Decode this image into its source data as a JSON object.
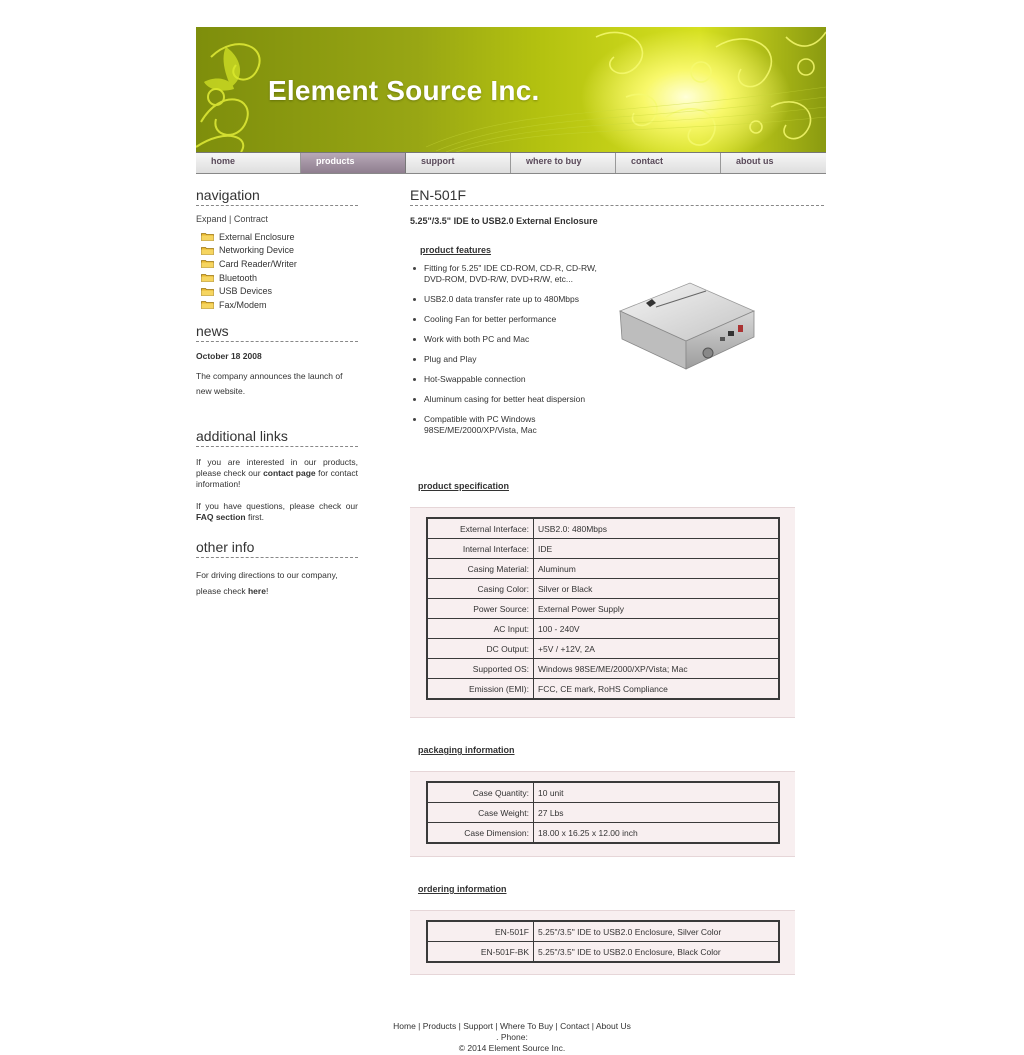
{
  "header": {
    "company": "Element Source Inc."
  },
  "topnav": [
    "home",
    "products",
    "support",
    "where to buy",
    "contact",
    "about us"
  ],
  "sidebar": {
    "nav_title": "navigation",
    "expand": "Expand",
    "separator": "|",
    "contract": "Contract",
    "categories": [
      "External Enclosure",
      "Networking Device",
      "Card Reader/Writer",
      "Bluetooth",
      "USB Devices",
      "Fax/Modem"
    ],
    "news_title": "news",
    "news_date": "October 18 2008",
    "news_text": "The company announces the launch of new website.",
    "links_title": "additional links",
    "links_p1_a": "If you are interested in our products, please check our ",
    "links_p1_b": "contact page",
    "links_p1_c": " for contact information!",
    "links_p2_a": "If you have questions, please check our ",
    "links_p2_b": "FAQ section",
    "links_p2_c": " first.",
    "other_title": "other info",
    "other_a": "For driving directions to our company, please check ",
    "other_b": "here",
    "other_c": "!"
  },
  "product": {
    "model": "EN-501F",
    "subtitle": "5.25\"/3.5\" IDE to USB2.0 External Enclosure",
    "features_title": "product features",
    "features": [
      "Fitting for 5.25\" IDE CD-ROM, CD-R, CD-RW, DVD-ROM, DVD-R/W, DVD+R/W, etc...",
      "USB2.0 data transfer rate up to 480Mbps",
      "Cooling Fan for better performance",
      "Work with both PC and Mac",
      "Plug and Play",
      "Hot-Swappable connection",
      "Aluminum casing for better heat dispersion",
      "Compatible with PC Windows 98SE/ME/2000/XP/Vista, Mac"
    ],
    "spec_title": "product specification",
    "spec": [
      [
        "External Interface:",
        "USB2.0: 480Mbps"
      ],
      [
        "Internal Interface:",
        "IDE"
      ],
      [
        "Casing Material:",
        "Aluminum"
      ],
      [
        "Casing Color:",
        "Silver or Black"
      ],
      [
        "Power Source:",
        "External Power Supply"
      ],
      [
        "AC Input:",
        "100 - 240V"
      ],
      [
        "DC Output:",
        "+5V / +12V, 2A"
      ],
      [
        "Supported OS:",
        "Windows 98SE/ME/2000/XP/Vista; Mac"
      ],
      [
        "Emission (EMI):",
        "FCC, CE mark, RoHS Compliance"
      ]
    ],
    "packaging_title": "packaging information",
    "packaging": [
      [
        "Case Quantity:",
        "10 unit"
      ],
      [
        "Case Weight:",
        "27 Lbs"
      ],
      [
        "Case Dimension:",
        "18.00 x 16.25 x 12.00 inch"
      ]
    ],
    "ordering_title": "ordering information",
    "ordering": [
      [
        "EN-501F",
        "5.25\"/3.5\" IDE to USB2.0 Enclosure, Silver Color"
      ],
      [
        "EN-501F-BK",
        "5.25\"/3.5\" IDE to USB2.0 Enclosure, Black Color"
      ]
    ]
  },
  "footer": {
    "links": [
      "Home",
      "Products",
      "Support",
      "Where To Buy",
      "Contact",
      "About Us"
    ],
    "sep": " | ",
    "phone": ". Phone:",
    "copyright": "© 2014 Element Source Inc."
  },
  "colors": {
    "banner": "#9aaa12",
    "active_tab": "#a393a3",
    "table_bg": "#f8eff0"
  }
}
